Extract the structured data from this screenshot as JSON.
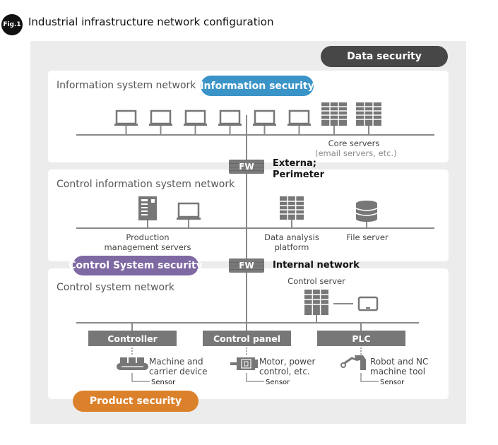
{
  "figure": {
    "badge": "Fig.1",
    "title": "Industrial infrastructure network configuration"
  },
  "security_labels": {
    "data": "Data security",
    "information": "Information security",
    "control_system": "Control System security",
    "product": "Product security"
  },
  "colors": {
    "data_security": "#474747",
    "information_security": "#3b94c8",
    "control_system_security": "#7f69a3",
    "product_security": "#dc812b"
  },
  "networks": {
    "information": {
      "label": "Information system network",
      "devices": [
        "laptop",
        "laptop",
        "laptop",
        "laptop",
        "laptop",
        "laptop",
        "server-rack",
        "server-rack"
      ],
      "core_servers_label": "Core servers",
      "core_servers_sub": "(email servers, etc.)"
    },
    "control_information": {
      "label": "Control information system network",
      "production_label_1": "Production",
      "production_label_2": "management servers",
      "data_analysis_1": "Data analysis",
      "data_analysis_2": "platform",
      "file_server": "File server"
    },
    "control_system": {
      "label": "Control system network",
      "control_server": "Control server",
      "boxes": [
        "Controller",
        "Control panel",
        "PLC"
      ],
      "devices": [
        {
          "line1": "Machine and",
          "line2": "carrier device",
          "sensor": "Sensor"
        },
        {
          "line1": "Motor, power",
          "line2": "control, etc.",
          "sensor": "Sensor"
        },
        {
          "line1": "Robot and NC",
          "line2": "machine tool",
          "sensor": "Sensor"
        }
      ]
    }
  },
  "firewalls": [
    {
      "label": "FW",
      "zone_line1": "Externa;",
      "zone_line2": "Perimeter"
    },
    {
      "label": "FW",
      "zone_line1": "Internal network",
      "zone_line2": ""
    }
  ]
}
